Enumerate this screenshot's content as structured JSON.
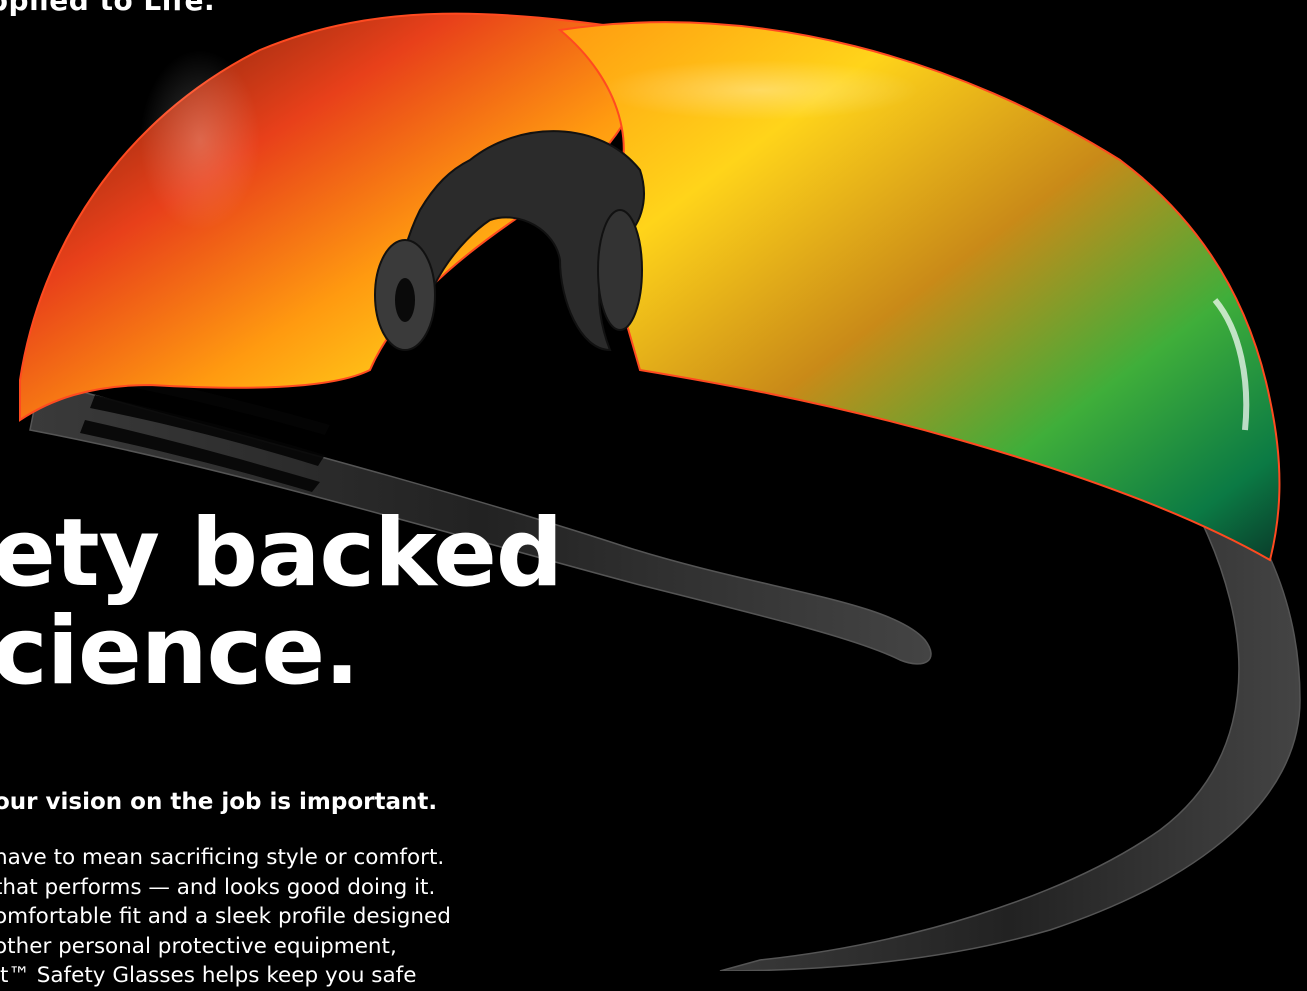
{
  "hero": {
    "tagline": "pplied to Life.",
    "image_subject": "safety-glasses-icon",
    "lens_colors": [
      "#ff3a1a",
      "#ff8a00",
      "#ffd400",
      "#2fae4a",
      "#0b6f3a"
    ],
    "frame_color": "#2a2a2a"
  },
  "headline": {
    "line1": "ety backed",
    "line2": "cience."
  },
  "subhead": "our vision on the job is important.",
  "body_lines": [
    "have to mean sacrificing style or comfort.",
    "that performs — and looks good doing it.",
    "omfortable fit and a sleek profile designed",
    "other personal protective equipment,",
    "it™ Safety Glasses helps keep you safe"
  ]
}
